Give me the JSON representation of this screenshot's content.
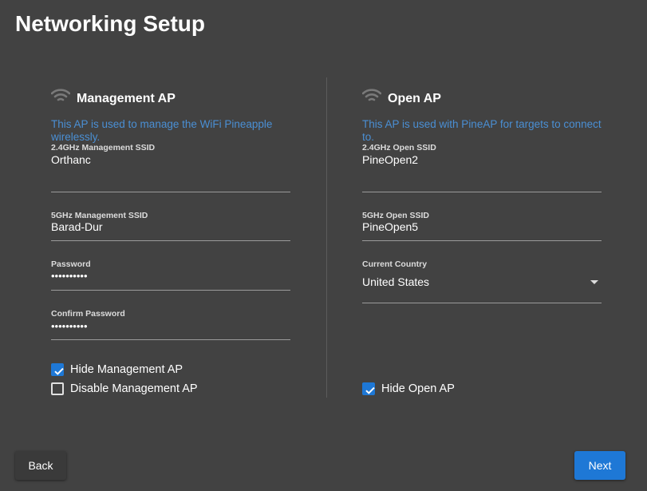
{
  "title": "Networking Setup",
  "management_ap": {
    "heading": "Management AP",
    "icon": "wifi-icon",
    "description": "This AP is used to manage the WiFi Pineapple wirelessly.",
    "fields": [
      {
        "label": "2.4GHz Management SSID",
        "value": "Orthanc"
      },
      {
        "label": "5GHz Management SSID",
        "value": "Barad-Dur"
      },
      {
        "label": "Password",
        "value": "••••••••••"
      },
      {
        "label": "Confirm Password",
        "value": "••••••••••"
      }
    ],
    "checkboxes": [
      {
        "label": "Hide Management AP",
        "checked": true
      },
      {
        "label": "Disable Management AP",
        "checked": false
      }
    ]
  },
  "open_ap": {
    "heading": "Open AP",
    "icon": "wifi-icon",
    "description": "This AP is used with PineAP for targets to connect to.",
    "fields": [
      {
        "label": "2.4GHz Open SSID",
        "value": "PineOpen2"
      },
      {
        "label": "5GHz Open SSID",
        "value": "PineOpen5"
      }
    ],
    "country": {
      "label": "Current Country",
      "value": "United States"
    },
    "checkboxes": [
      {
        "label": "Hide Open AP",
        "checked": true
      }
    ]
  },
  "buttons": {
    "back": "Back",
    "next": "Next"
  },
  "colors": {
    "background": "#424242",
    "accent": "#1e78d6",
    "description": "#4a8fd4"
  }
}
